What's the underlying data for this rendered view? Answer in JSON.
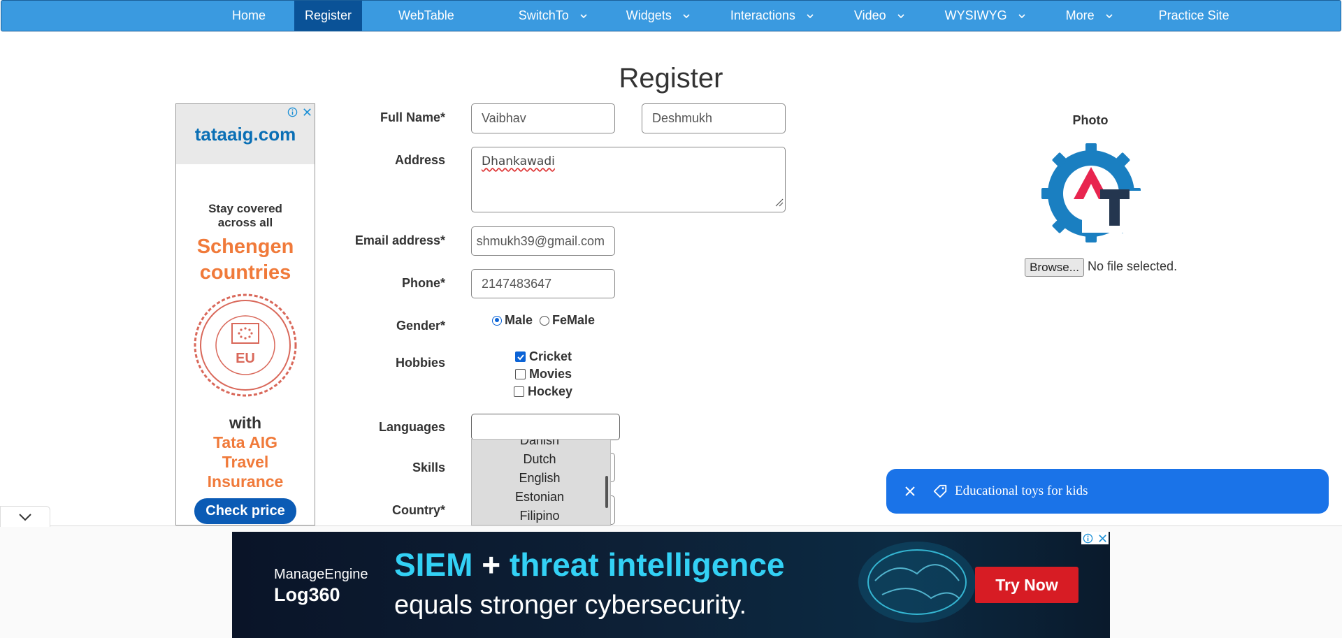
{
  "nav": {
    "items": [
      {
        "label": "Home",
        "dropdown": false,
        "active": false
      },
      {
        "label": "Register",
        "dropdown": false,
        "active": true
      },
      {
        "label": "WebTable",
        "dropdown": false,
        "active": false
      },
      {
        "label": "SwitchTo",
        "dropdown": true,
        "active": false
      },
      {
        "label": "Widgets",
        "dropdown": true,
        "active": false
      },
      {
        "label": "Interactions",
        "dropdown": true,
        "active": false
      },
      {
        "label": "Video",
        "dropdown": true,
        "active": false
      },
      {
        "label": "WYSIWYG",
        "dropdown": true,
        "active": false
      },
      {
        "label": "More",
        "dropdown": true,
        "active": false
      },
      {
        "label": "Practice Site",
        "dropdown": false,
        "active": false
      }
    ],
    "bar_color": "#3a9ae0",
    "active_color": "#0a5297"
  },
  "page": {
    "title": "Register"
  },
  "form": {
    "full_name_label": "Full Name*",
    "first_name": "Vaibhav",
    "last_name": "Deshmukh",
    "address_label": "Address",
    "address": "Dhankawadi",
    "email_label": "Email address*",
    "email": "shmukh39@gmail.com",
    "phone_label": "Phone*",
    "phone": "2147483647",
    "gender_label": "Gender*",
    "gender_options": [
      {
        "label": "Male",
        "selected": true
      },
      {
        "label": "FeMale",
        "selected": false
      }
    ],
    "hobbies_label": "Hobbies",
    "hobbies": [
      {
        "label": "Cricket",
        "checked": true
      },
      {
        "label": "Movies",
        "checked": false
      },
      {
        "label": "Hockey",
        "checked": false
      }
    ],
    "languages_label": "Languages",
    "languages_value": "",
    "language_options_visible": [
      "Danish",
      "Dutch",
      "English",
      "Estonian",
      "Filipino"
    ],
    "skills_label": "Skills",
    "country_label": "Country*"
  },
  "photo": {
    "label": "Photo",
    "browse_label": "Browse...",
    "file_status": "No file selected.",
    "logo_letters": "AT"
  },
  "left_ad": {
    "brand": "tataaig.com",
    "line1": "Stay covered across all",
    "highlight": "Schengen countries",
    "stamp_text": "SCHENGEN VISA · TRAVEL INSURANCE MANDATORY · EU",
    "with": "with",
    "product": "Tata AIG Travel Insurance",
    "cta": "Check price"
  },
  "toast": {
    "text": "Educational toys for kids",
    "close_icon": "close-icon",
    "tag_icon": "tag-icon"
  },
  "bottom_ad": {
    "brand_line1": "ManageEngine",
    "brand_line2": "Log360",
    "headline_part1": "SIEM",
    "headline_plus": " + ",
    "headline_part2": "threat intelligence",
    "subline": "equals stronger cybersecurity.",
    "cta": "Try Now"
  }
}
